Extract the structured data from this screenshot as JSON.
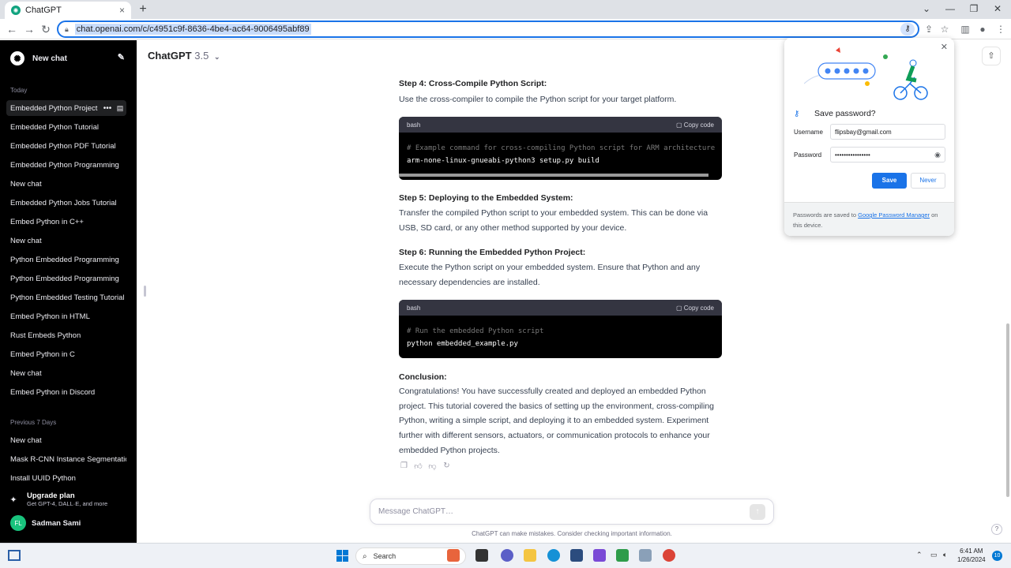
{
  "browser": {
    "tab_title": "ChatGPT",
    "tab_favicon": "✺",
    "tab_close": "×",
    "new_tab": "+",
    "url": "chat.openai.com/c/c4951c9f-8636-4be4-ac64-9006495abf89",
    "window_controls": [
      "⌄",
      "—",
      "❐",
      "✕"
    ]
  },
  "sidebar": {
    "new_chat_label": "New chat",
    "group_today": "Today",
    "today_items": [
      "Embedded Python Project",
      "Embedded Python Tutorial",
      "Embedded Python PDF Tutorial",
      "Embedded Python Programming",
      "New chat",
      "Embedded Python Jobs Tutorial",
      "Embed Python in C++",
      "New chat",
      "Python Embedded Programming",
      "Python Embedded Programming",
      "Python Embedded Testing Tutorial",
      "Embed Python in HTML",
      "Rust Embeds Python",
      "Embed Python in C",
      "New chat",
      "Embed Python in Discord"
    ],
    "group_previous": "Previous 7 Days",
    "previous_items": [
      "New chat",
      "Mask R-CNN Instance Segmentation",
      "Install UUID Python"
    ],
    "upgrade_title": "Upgrade plan",
    "upgrade_sub": "Get GPT-4, DALL·E, and more",
    "user_initials": "FL",
    "user_name": "Sadman Sami"
  },
  "header": {
    "model_name": "ChatGPT",
    "model_version": "3.5",
    "chevron": "⌄"
  },
  "conversation": {
    "step4_title": "Step 4: Cross-Compile Python Script:",
    "step4_text": "Use the cross-compiler to compile the Python script for your target platform.",
    "code1": {
      "lang": "bash",
      "copy_label": "Copy code",
      "comment": "# Example command for cross-compiling Python script for ARM architecture",
      "command": "arm-none-linux-gnueabi-python3 setup.py build"
    },
    "step5_title": "Step 5: Deploying to the Embedded System:",
    "step5_text": "Transfer the compiled Python script to your embedded system. This can be done via USB, SD card, or any other method supported by your device.",
    "step6_title": "Step 6: Running the Embedded Python Project:",
    "step6_text": "Execute the Python script on your embedded system. Ensure that Python and any necessary dependencies are installed.",
    "code2": {
      "lang": "bash",
      "copy_label": "Copy code",
      "comment": "# Run the embedded Python script",
      "command": "python embedded_example.py"
    },
    "conclusion_title": "Conclusion:",
    "conclusion_text": "Congratulations! You have successfully created and deployed an embedded Python project. This tutorial covered the basics of setting up the environment, cross-compiling Python, writing a simple script, and deploying it to an embedded system. Experiment further with different sensors, actuators, or communication protocols to enhance your embedded Python projects."
  },
  "composer": {
    "placeholder": "Message ChatGPT…",
    "disclaimer": "ChatGPT can make mistakes. Consider checking important information.",
    "help": "?"
  },
  "password_popup": {
    "title": "Save password?",
    "username_label": "Username",
    "username_value": "flipsbay@gmail.com",
    "password_label": "Password",
    "password_value": "••••••••••••••••",
    "save_label": "Save",
    "never_label": "Never",
    "footer_prefix": "Passwords are saved to ",
    "footer_link": "Google Password Manager",
    "footer_suffix": " on this device."
  },
  "taskbar": {
    "search_label": "Search",
    "time": "6:41 AM",
    "date": "1/26/2024",
    "notifications": "10"
  },
  "colors": {
    "sidebar_bg": "#000000",
    "accent_blue": "#1a73e8",
    "avatar_green": "#19c37d",
    "code_bg": "#000000"
  }
}
